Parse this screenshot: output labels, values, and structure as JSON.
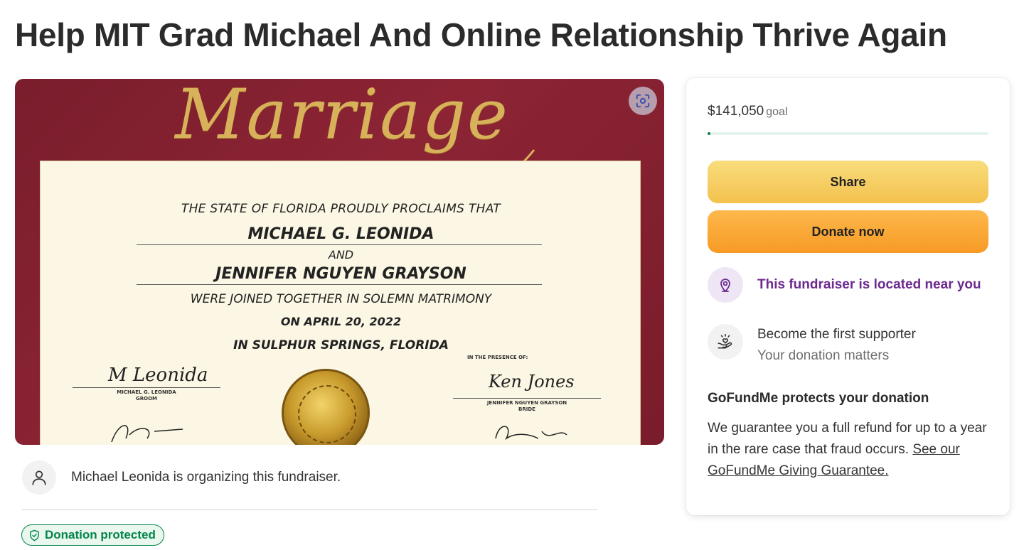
{
  "page": {
    "title": "Help MIT Grad Michael And Online Relationship Thrive Again"
  },
  "hero": {
    "script_title": "Marriage",
    "certificate": {
      "line1": "THE STATE OF FLORIDA PROUDLY PROCLAIMS THAT",
      "groom_name": "MICHAEL G. LEONIDA",
      "and": "AND",
      "bride_name": "JENNIFER NGUYEN GRAYSON",
      "line5": "WERE JOINED TOGETHER IN SOLEMN MATRIMONY",
      "date": "ON APRIL 20, 2022",
      "place": "IN SULPHUR SPRINGS, FLORIDA",
      "presence": "IN THE PRESENCE OF:",
      "groom_caption": "MICHAEL G. LEONIDA",
      "groom_role": "GROOM",
      "bride_caption": "JENNIFER NGUYEN GRAYSON",
      "bride_role": "BRIDE",
      "groom_signature": "M Leonida",
      "bride_signature": "Ken Jones"
    },
    "scan_icon": "image-scan-icon"
  },
  "organizer": {
    "avatar_icon": "user-icon",
    "text": "Michael Leonida is organizing this fundraiser."
  },
  "badge": {
    "icon": "shield-icon",
    "label": "Donation protected"
  },
  "card": {
    "goal_amount": "$141,050",
    "goal_label": "goal",
    "progress_fraction": 0.01,
    "share_label": "Share",
    "donate_label": "Donate now",
    "near_icon": "location-pin-icon",
    "near_text": "This fundraiser is located near you",
    "first_icon": "heart-hands-icon",
    "first_title": "Become the first supporter",
    "first_sub": "Your donation matters",
    "protect_heading": "GoFundMe protects your donation",
    "protect_body": "We guarantee you a full refund for up to a year in the rare case that fraud occurs. ",
    "protect_link": "See our GoFundMe Giving Guarantee."
  },
  "colors": {
    "accent_green": "#008548",
    "share_yellow": "#f3c14e",
    "donate_orange": "#f79a25",
    "purple": "#6b2a8e",
    "maroon": "#7a1d2c"
  }
}
